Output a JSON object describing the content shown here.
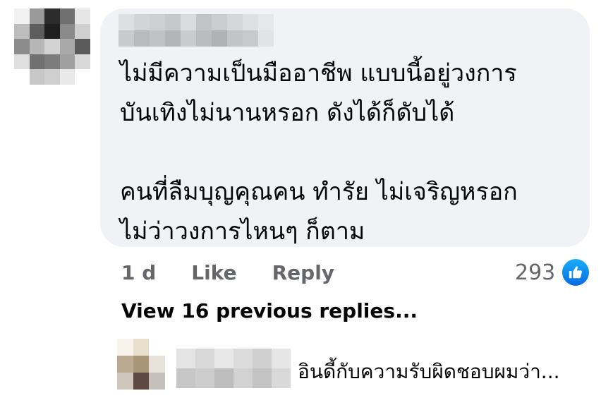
{
  "comment": {
    "text": "ไม่มีความเป็นมืออาชีพ แบบนี้อยู่วงการ\nบันเทิงไม่นานหรอก ดังได้ก็ดับได้\n\nคนที่ลืมบุญคุณคน ทำรัย ไม่เจริญหรอก\nไม่ว่าวงการไหนๆ ก็ตาม",
    "time": "1 d",
    "like_label": "Like",
    "reply_label": "Reply",
    "reaction_count": "293",
    "reaction_icon": "like-thumb-icon"
  },
  "replies": {
    "view_previous_label": "View 16 previous replies...",
    "preview_text": "อินดี้กับความรับผิดชอบผมว่า..."
  },
  "colors": {
    "bubble_bg": "#f0f2f5",
    "meta_text": "#65676b",
    "like_blue": "#1877f2"
  }
}
